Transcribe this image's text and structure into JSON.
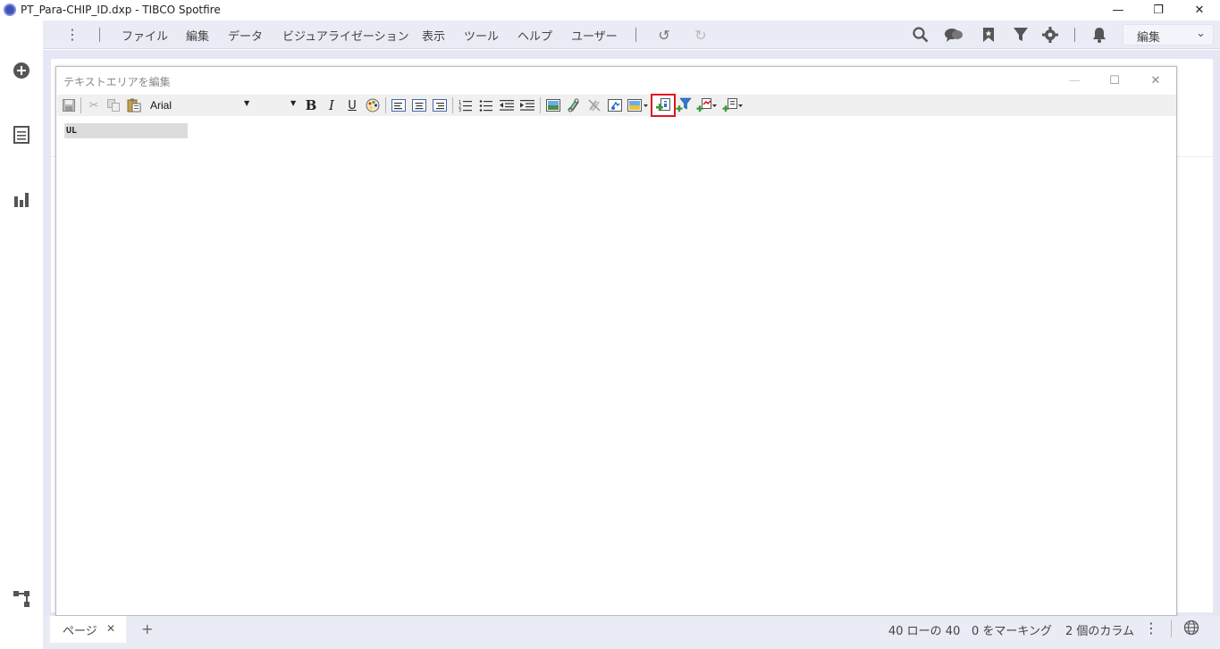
{
  "window": {
    "title": "PT_Para-CHIP_ID.dxp - TIBCO Spotfire",
    "min_glyph": "—",
    "restore_glyph": "❐",
    "close_glyph": "✕"
  },
  "menubar": {
    "items": [
      "ファイル",
      "編集",
      "データ",
      "ビジュアライゼーション",
      "表示",
      "ツール",
      "ヘルプ",
      "ユーザー"
    ],
    "mode_label": "編集"
  },
  "dialog": {
    "title": "テキストエリアを編集",
    "font_name": "Arial",
    "editor_text": "UL"
  },
  "statusbar": {
    "page_tab": "ページ",
    "rows": "40 ローの 40",
    "marked": "0 をマーキング",
    "columns": "2 個のカラム"
  },
  "colors": {
    "accent": "#3f51b5",
    "highlight_border": "#e0141e",
    "menubar_bg": "#e9ebf5"
  }
}
